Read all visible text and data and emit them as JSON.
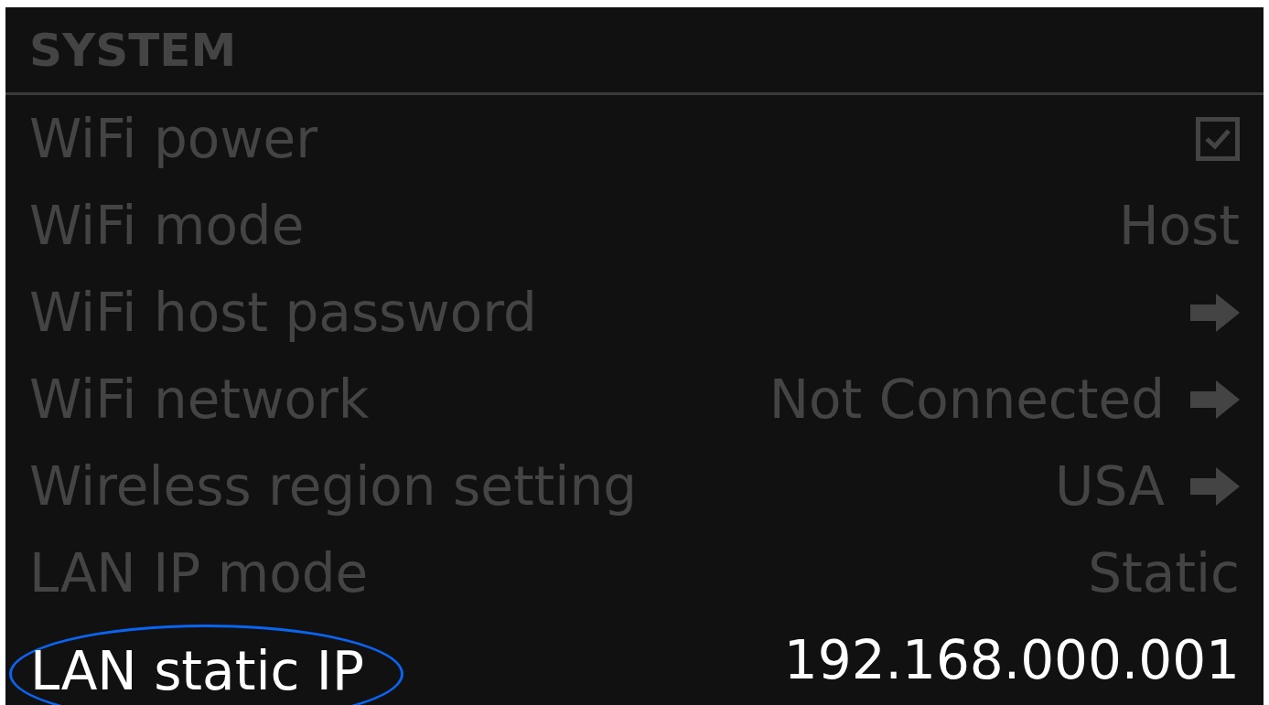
{
  "section": {
    "title": "SYSTEM"
  },
  "items": [
    {
      "label": "WiFi power",
      "kind": "checkbox",
      "checked": true,
      "selected": false
    },
    {
      "label": "WiFi mode",
      "kind": "value",
      "value": "Host",
      "selected": false
    },
    {
      "label": "WiFi host password",
      "kind": "link",
      "selected": false
    },
    {
      "label": "WiFi network",
      "kind": "link",
      "value": "Not Connected",
      "selected": false
    },
    {
      "label": "Wireless region setting",
      "kind": "link",
      "value": "USA",
      "selected": false
    },
    {
      "label": "LAN IP mode",
      "kind": "value",
      "value": "Static",
      "selected": false
    },
    {
      "label": "LAN static IP",
      "kind": "value",
      "value": "192.168.000.001",
      "selected": true
    }
  ]
}
